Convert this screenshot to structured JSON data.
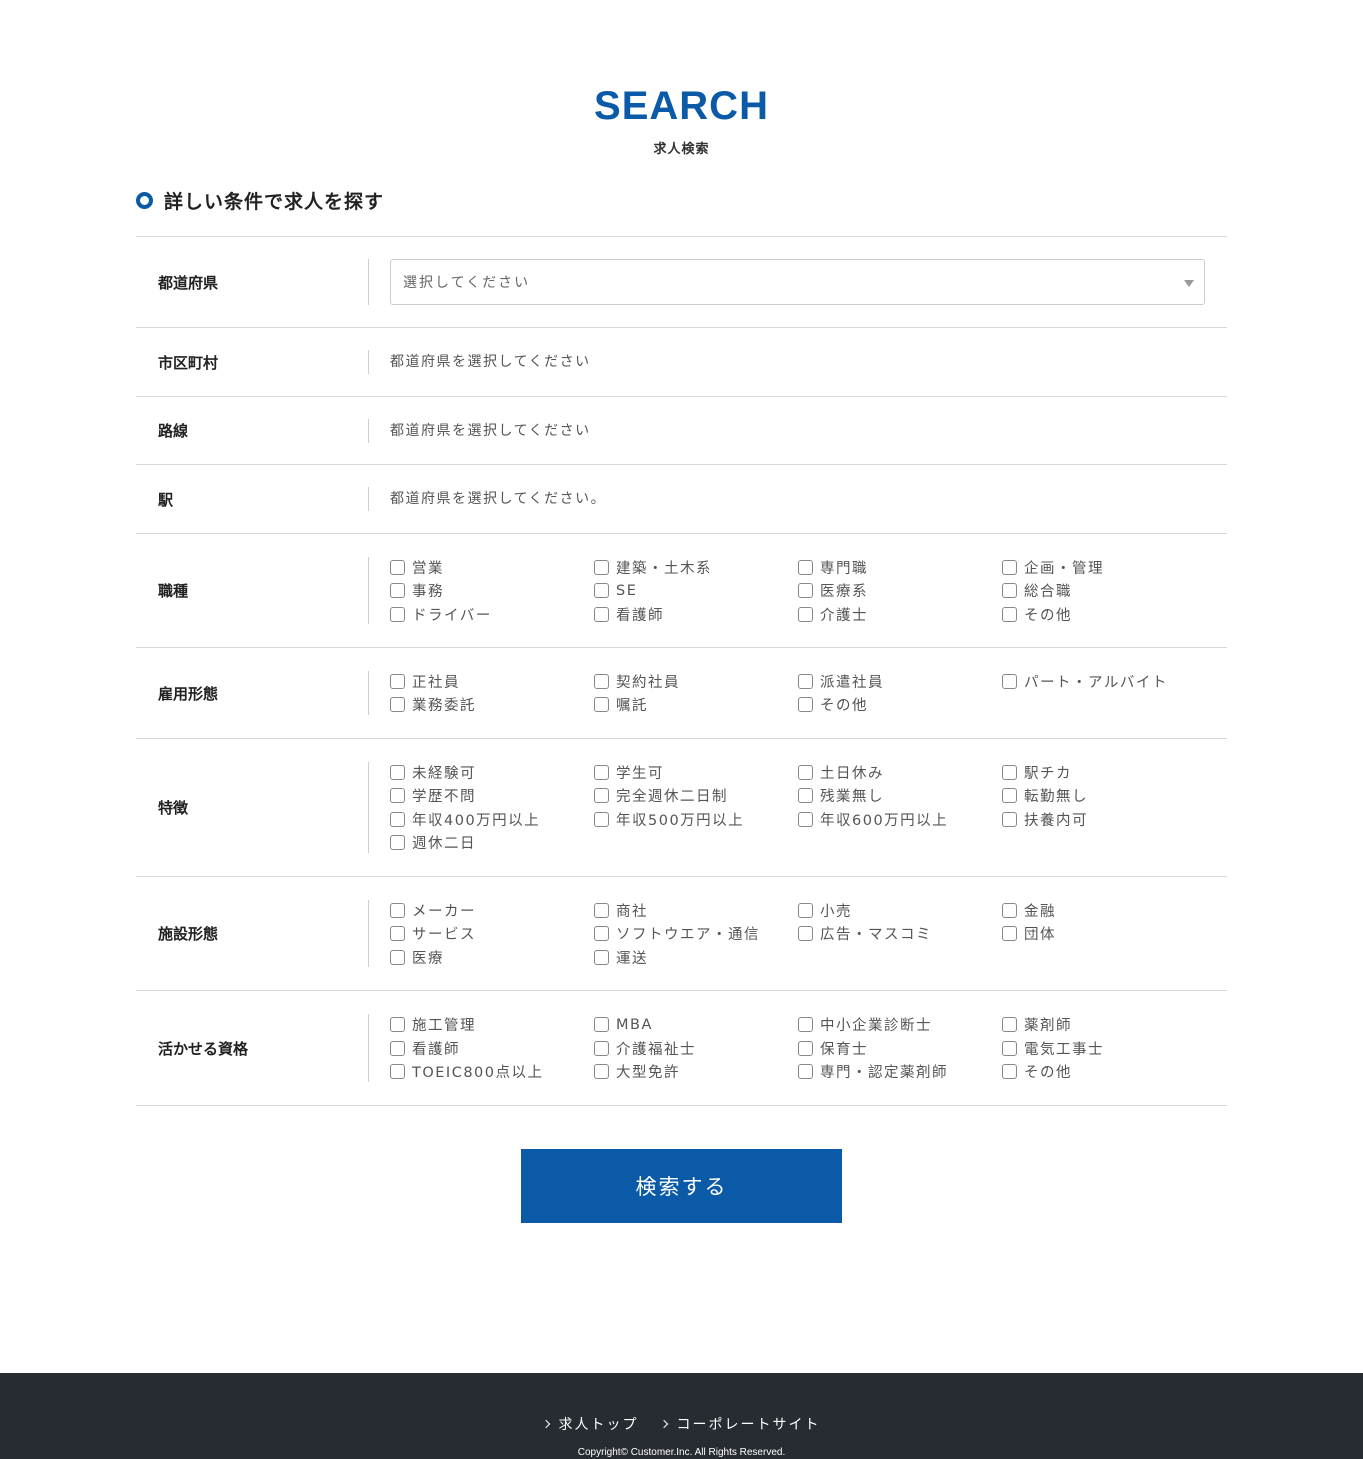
{
  "header": {
    "title": "SEARCH",
    "subtitle": "求人検索"
  },
  "section": {
    "heading": "詳しい条件で求人を探す"
  },
  "colors": {
    "accent": "#0a5aa8",
    "footer_bg": "#272b32"
  },
  "rows": {
    "prefecture": {
      "label": "都道府県",
      "placeholder": "選択してください"
    },
    "city": {
      "label": "市区町村",
      "value": "都道府県を選択してください"
    },
    "line": {
      "label": "路線",
      "value": "都道府県を選択してください"
    },
    "station": {
      "label": "駅",
      "value": "都道府県を選択してください。"
    },
    "job_type": {
      "label": "職種",
      "options": [
        "営業",
        "建築・土木系",
        "専門職",
        "企画・管理",
        "事務",
        "SE",
        "医療系",
        "総合職",
        "ドライバー",
        "看護師",
        "介護士",
        "その他"
      ]
    },
    "employment": {
      "label": "雇用形態",
      "options": [
        "正社員",
        "契約社員",
        "派遣社員",
        "パート・アルバイト",
        "業務委託",
        "嘱託",
        "その他"
      ]
    },
    "features": {
      "label": "特徴",
      "options": [
        "未経験可",
        "学生可",
        "土日休み",
        "駅チカ",
        "学歴不問",
        "完全週休二日制",
        "残業無し",
        "転勤無し",
        "年収400万円以上",
        "年収500万円以上",
        "年収600万円以上",
        "扶養内可",
        "週休二日"
      ]
    },
    "facility": {
      "label": "施設形態",
      "options": [
        "メーカー",
        "商社",
        "小売",
        "金融",
        "サービス",
        "ソフトウエア・通信",
        "広告・マスコミ",
        "団体",
        "医療",
        "運送"
      ]
    },
    "qualifications": {
      "label": "活かせる資格",
      "options": [
        "施工管理",
        "MBA",
        "中小企業診断士",
        "薬剤師",
        "看護師",
        "介護福祉士",
        "保育士",
        "電気工事士",
        "TOEIC800点以上",
        "大型免許",
        "専門・認定薬剤師",
        "その他"
      ]
    }
  },
  "submit": {
    "label": "検索する"
  },
  "footer": {
    "links": [
      "求人トップ",
      "コーポレートサイト"
    ],
    "copyright": "Copyright© Customer.Inc. All Rights Reserved."
  }
}
